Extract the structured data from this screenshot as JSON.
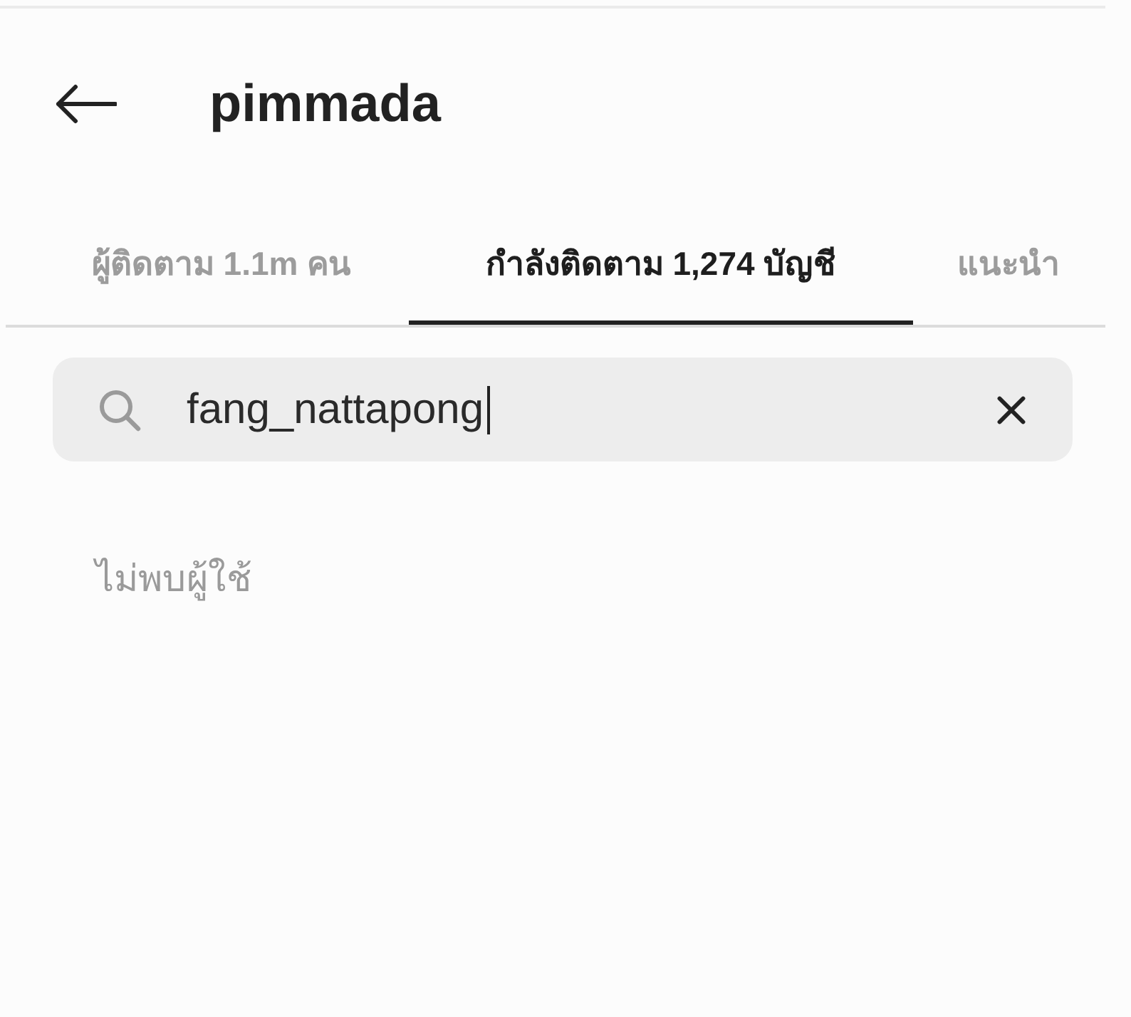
{
  "header": {
    "title": "pimmada"
  },
  "tabs": [
    {
      "label": "ผู้ติดตาม 1.1m คน",
      "selected": false
    },
    {
      "label": "กำลังติดตาม 1,274 บัญชี",
      "selected": true
    },
    {
      "label": "แนะนำ",
      "selected": false
    }
  ],
  "search": {
    "value": "fang_nattapong",
    "focused": true
  },
  "message": "ไม่พบผู้ใช้"
}
